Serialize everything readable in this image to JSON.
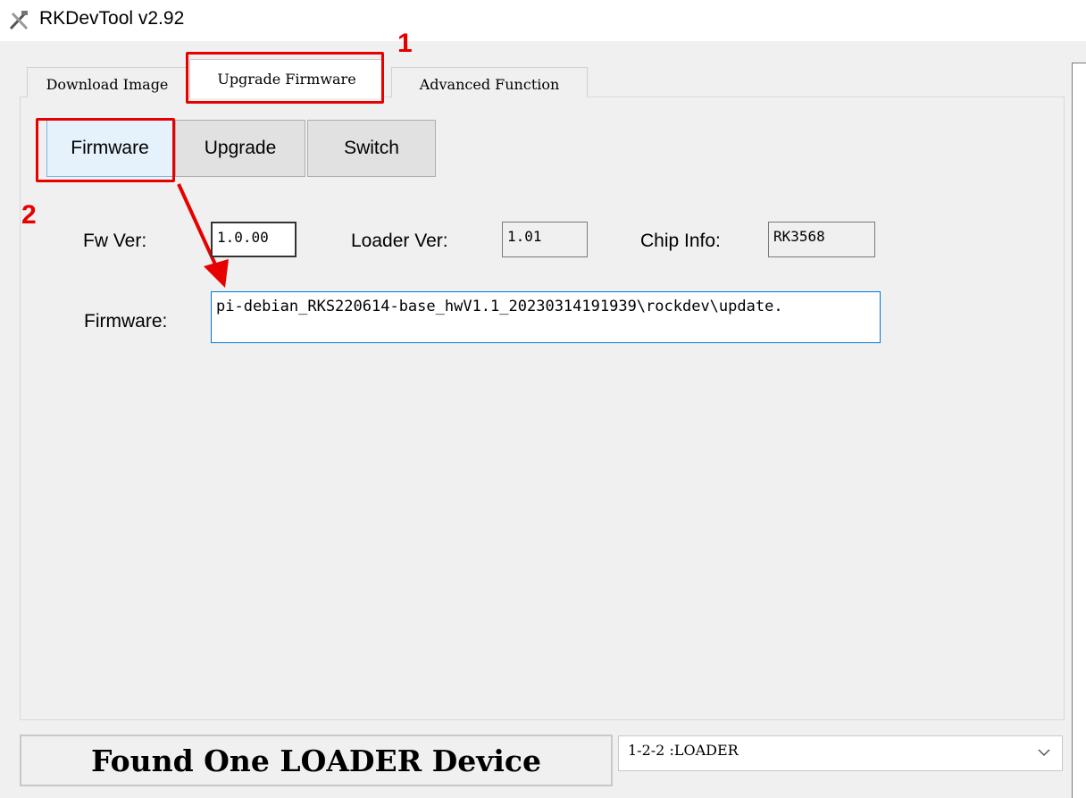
{
  "window": {
    "title": "RKDevTool v2.92",
    "icon": "tools-icon"
  },
  "tabs": [
    {
      "label": "Download Image",
      "active": false
    },
    {
      "label": "Upgrade Firmware",
      "active": true
    },
    {
      "label": "Advanced Function",
      "active": false
    }
  ],
  "buttons": {
    "firmware": "Firmware",
    "upgrade": "Upgrade",
    "switch": "Switch"
  },
  "info": {
    "fw_ver_label": "Fw Ver:",
    "fw_ver_value": "1.0.00",
    "loader_ver_label": "Loader Ver:",
    "loader_ver_value": "1.01",
    "chip_info_label": "Chip Info:",
    "chip_info_value": "RK3568",
    "firmware_label": "Firmware:",
    "firmware_path": "pi-debian_RKS220614-base_hwV1.1_20230314191939\\rockdev\\update."
  },
  "annotations": {
    "step1": "1",
    "step2": "2",
    "color": "#e60000"
  },
  "status": {
    "message": "Found One LOADER Device",
    "device_selected": "1-2-2 :LOADER"
  }
}
